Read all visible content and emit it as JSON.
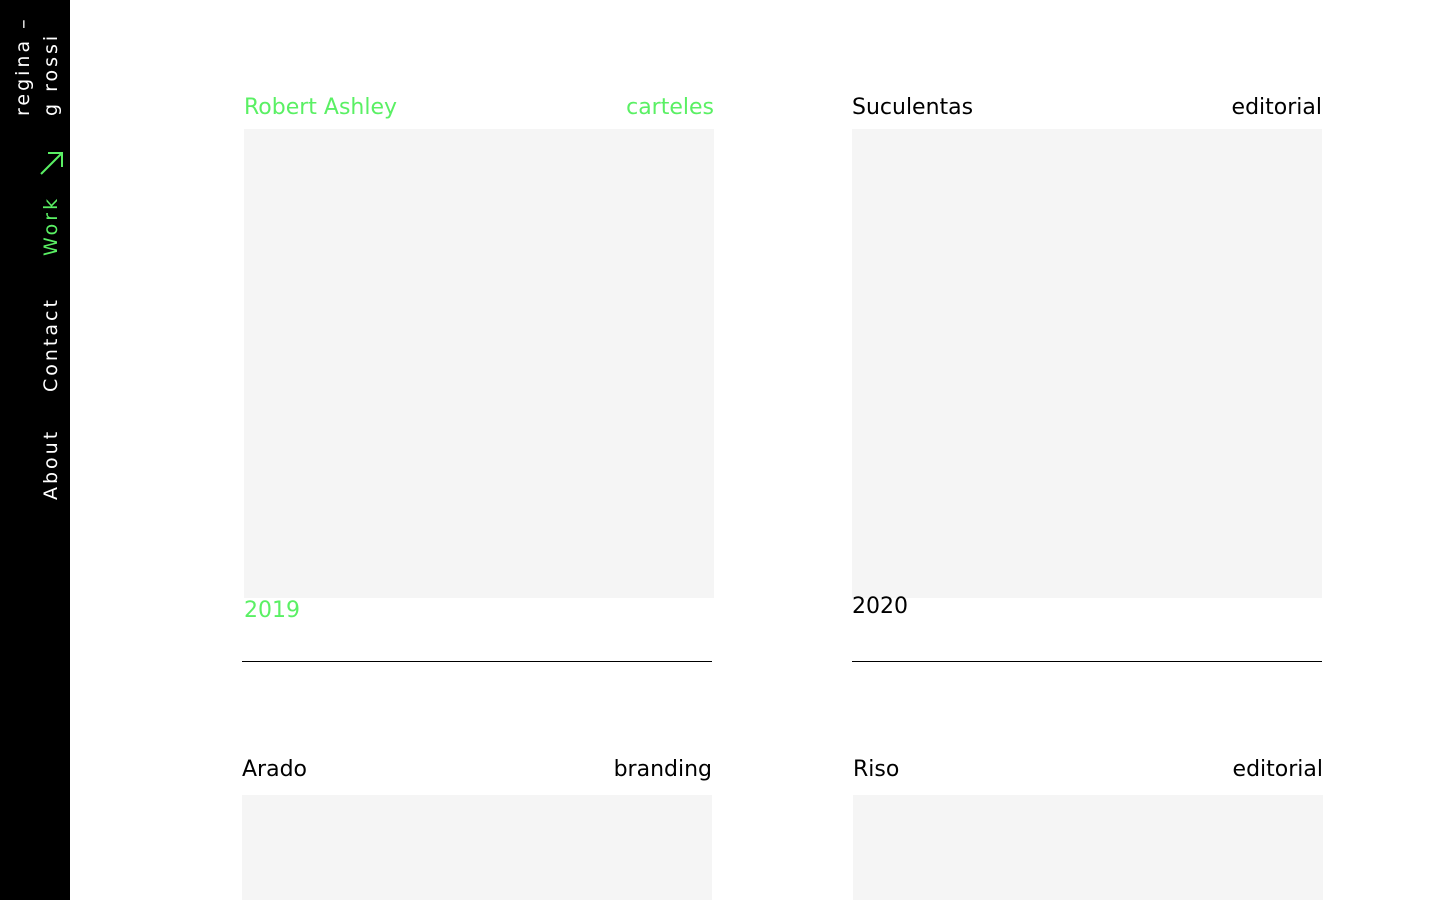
{
  "brand": {
    "line1": "regina –",
    "line2": "g rossi"
  },
  "nav": {
    "items": [
      {
        "label": "Work",
        "active": true
      },
      {
        "label": "Contact",
        "active": false
      },
      {
        "label": "About",
        "active": false
      }
    ],
    "active_indicator_icon": "arrow-up-right-icon"
  },
  "colors": {
    "accent": "#5af064",
    "sidebar_bg": "#000000",
    "text": "#000000",
    "thumb_bg": "#f5f5f5",
    "page_bg": "#ffffff"
  },
  "projects": [
    {
      "title": "Robert Ashley",
      "category": "carteles",
      "year": "2019",
      "highlighted": true
    },
    {
      "title": "Suculentas",
      "category": "editorial",
      "year": "2020",
      "highlighted": false
    },
    {
      "title": "Arado",
      "category": "branding",
      "year": "",
      "highlighted": false
    },
    {
      "title": "Riso",
      "category": "editorial",
      "year": "",
      "highlighted": false
    }
  ]
}
